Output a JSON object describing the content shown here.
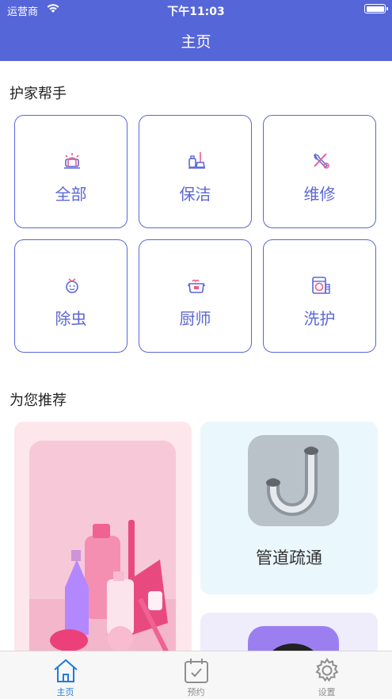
{
  "status": {
    "carrier": "运营商",
    "time": "下午11:03"
  },
  "header": {
    "title": "主页"
  },
  "helper": {
    "title": "护家帮手",
    "items": [
      {
        "label": "全部",
        "icon": "alarm-icon"
      },
      {
        "label": "保洁",
        "icon": "cleaning-icon"
      },
      {
        "label": "维修",
        "icon": "repair-tools-icon"
      },
      {
        "label": "除虫",
        "icon": "bug-icon"
      },
      {
        "label": "厨师",
        "icon": "chef-pot-icon"
      },
      {
        "label": "洗护",
        "icon": "washing-machine-icon"
      }
    ]
  },
  "recommend": {
    "title": "为您推荐",
    "cards": [
      {
        "label": "",
        "image": "cleaning-supplies-photo",
        "bg": "#fde6ec"
      },
      {
        "label": "管道疏通",
        "image": "pipe-photo",
        "bg": "#eaf7fc"
      },
      {
        "label": "",
        "image": "purple-card-photo",
        "bg": "#efedfb"
      }
    ]
  },
  "tabbar": {
    "items": [
      {
        "label": "主页",
        "icon": "home-icon",
        "active": true
      },
      {
        "label": "预约",
        "icon": "calendar-icon",
        "active": false
      },
      {
        "label": "设置",
        "icon": "gear-icon",
        "active": false
      }
    ]
  },
  "colors": {
    "primary": "#5566d9",
    "accent": "#5a67d8",
    "tab_active": "#1e7be0",
    "icon_pink": "#f05a8c"
  }
}
